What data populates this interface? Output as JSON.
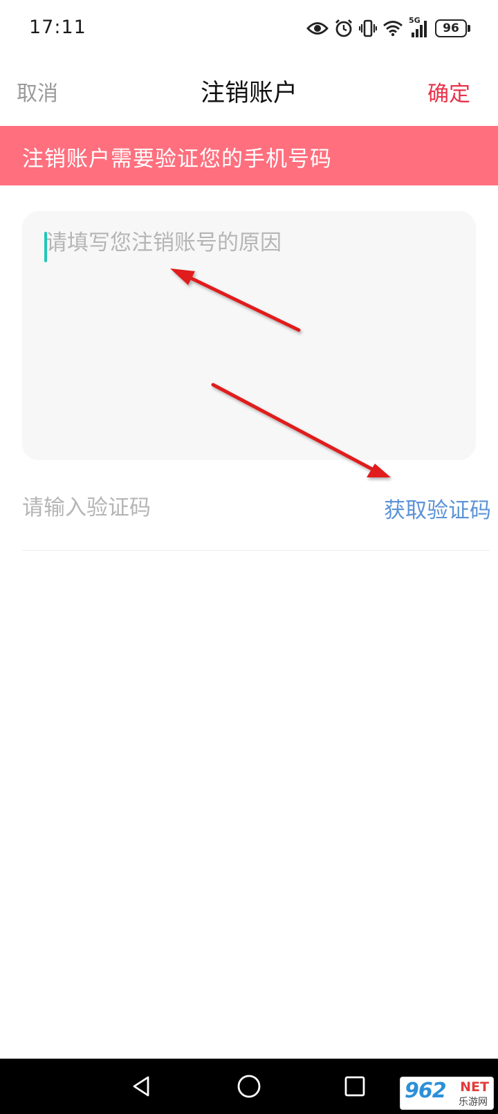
{
  "status_bar": {
    "time": "17:11",
    "network": "5G",
    "battery": "96",
    "icons": [
      "eye-icon",
      "alarm-icon",
      "vibrate-icon",
      "wifi-icon",
      "signal-icon",
      "battery-icon"
    ]
  },
  "nav": {
    "cancel_label": "取消",
    "title": "注销账户",
    "confirm_label": "确定"
  },
  "banner": {
    "text": "注销账户需要验证您的手机号码"
  },
  "reason": {
    "placeholder": "请填写您注销账号的原因",
    "value": ""
  },
  "code": {
    "placeholder": "请输入验证码",
    "value": "",
    "get_code_label": "获取验证码"
  },
  "watermark": {
    "number": "962",
    "net": "NET",
    "sub": "乐游网"
  },
  "colors": {
    "banner": "#ff6f7e",
    "confirm": "#e8334a",
    "link": "#5b93d8",
    "caret": "#1fc7b8",
    "arrow": "#e01f1f"
  }
}
